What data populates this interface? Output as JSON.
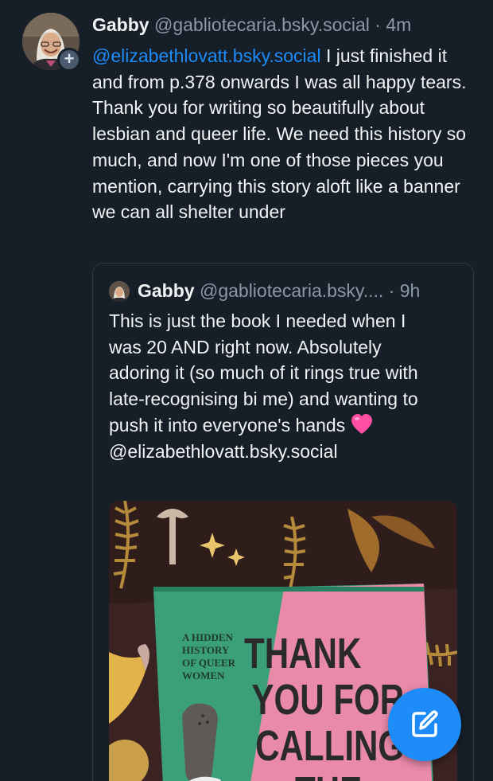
{
  "post": {
    "author_name": "Gabby",
    "author_handle": "@gabliotecaria.bsky.social",
    "separator": "·",
    "time": "4m",
    "mention": "@elizabethlovatt.bsky.social",
    "text_line1": " I just",
    "text_rest": "finished it and from p.378 onwards I was all happy tears. Thank you for writing so beautifully about lesbian and queer life. We need this history so much, and now I'm one of those pieces you mention, carrying this story aloft like a banner we can all shelter under"
  },
  "quoted_post": {
    "author_name": "Gabby",
    "author_handle": "@gabliotecaria.bsky....",
    "separator": "·",
    "time": "9h",
    "text": "This is just the book I needed when I was 20 AND right now. Absolutely adoring it (so much of it rings true with late-recognising bi me) and wanting to push it into everyone's hands",
    "emoji": "pink-heart",
    "mention": "@elizabethlovatt.bsky.social",
    "image": {
      "book_subtitle_l1": "A HIDDEN",
      "book_subtitle_l2": "HISTORY",
      "book_subtitle_l3": "OF QUEER",
      "book_subtitle_l4": "WOMEN",
      "book_title_l1": "THANK",
      "book_title_l2": "YOU FOR",
      "book_title_l3": "CALLING",
      "book_title_l4": "THE"
    }
  },
  "fab": {
    "icon": "compose-icon"
  },
  "colors": {
    "background": "#161e27",
    "accent": "#1d8cf8",
    "muted": "#8b98a8",
    "text": "#f1f3f5"
  }
}
